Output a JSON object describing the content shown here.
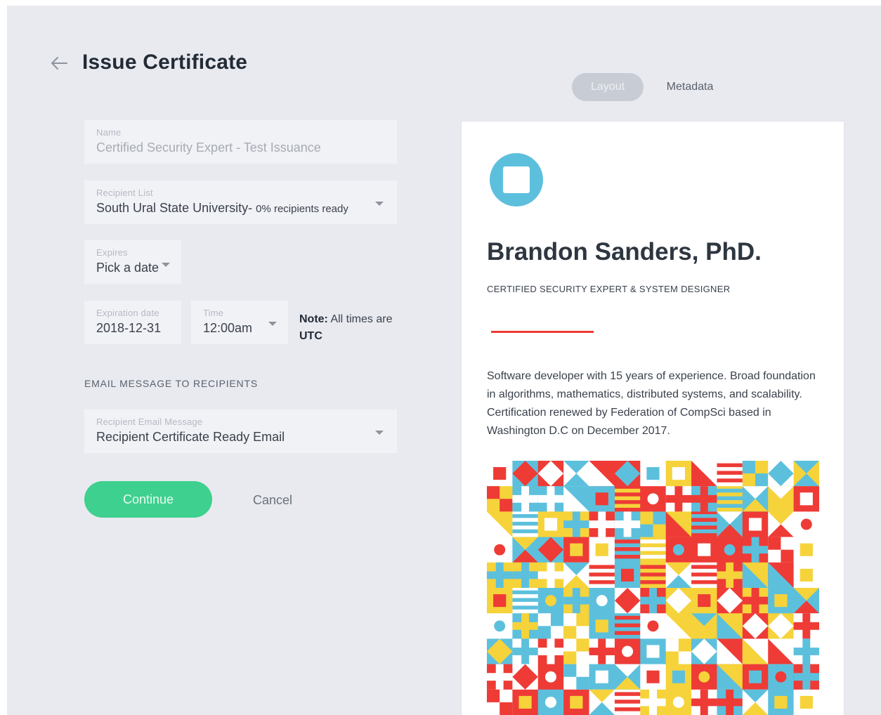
{
  "header": {
    "title": "Issue Certificate",
    "back_icon": "arrow-left-icon"
  },
  "form": {
    "name": {
      "label": "Name",
      "value": "Certified Security Expert - Test Issuance"
    },
    "recipient_list": {
      "label": "Recipient List",
      "value": "South Ural State University-",
      "status": "0% recipients ready"
    },
    "expires": {
      "label": "Expires",
      "value": "Pick a date"
    },
    "expiration_date": {
      "label": "Expiration date",
      "value": "2018-12-31"
    },
    "time": {
      "label": "Time",
      "value": "12:00am"
    },
    "note": {
      "bold": "Note:",
      "text1": " All times are ",
      "zone": "UTC"
    },
    "email_section_heading": "EMAIL MESSAGE TO RECIPIENTS",
    "email_message": {
      "label": "Recipient Email Message",
      "value": "Recipient Certificate Ready Email"
    },
    "continue_label": "Continue",
    "cancel_label": "Cancel"
  },
  "preview": {
    "tabs": [
      "Layout",
      "Metadata"
    ],
    "active_tab": "Layout",
    "certificate": {
      "name": "Brandon Sanders, PhD.",
      "subtitle": "CERTIFIED SECURITY EXPERT & SYSTEM DESIGNER",
      "description": "Software developer with 15 years of experience. Broad foundation in algorithms, mathematics, distributed systems, and scalability. Certification renewed by Federation of CompSci based in Washington D.C on December 2017."
    }
  },
  "colors": {
    "background": "#e8eaf0",
    "field": "#f1f2f6",
    "accent_green": "#3ed08e",
    "logo_blue": "#5cc0dd",
    "divider_red": "#ee3b36",
    "pattern": [
      "#ee3b36",
      "#5cc0dd",
      "#f6d33a",
      "#ffffff"
    ]
  }
}
